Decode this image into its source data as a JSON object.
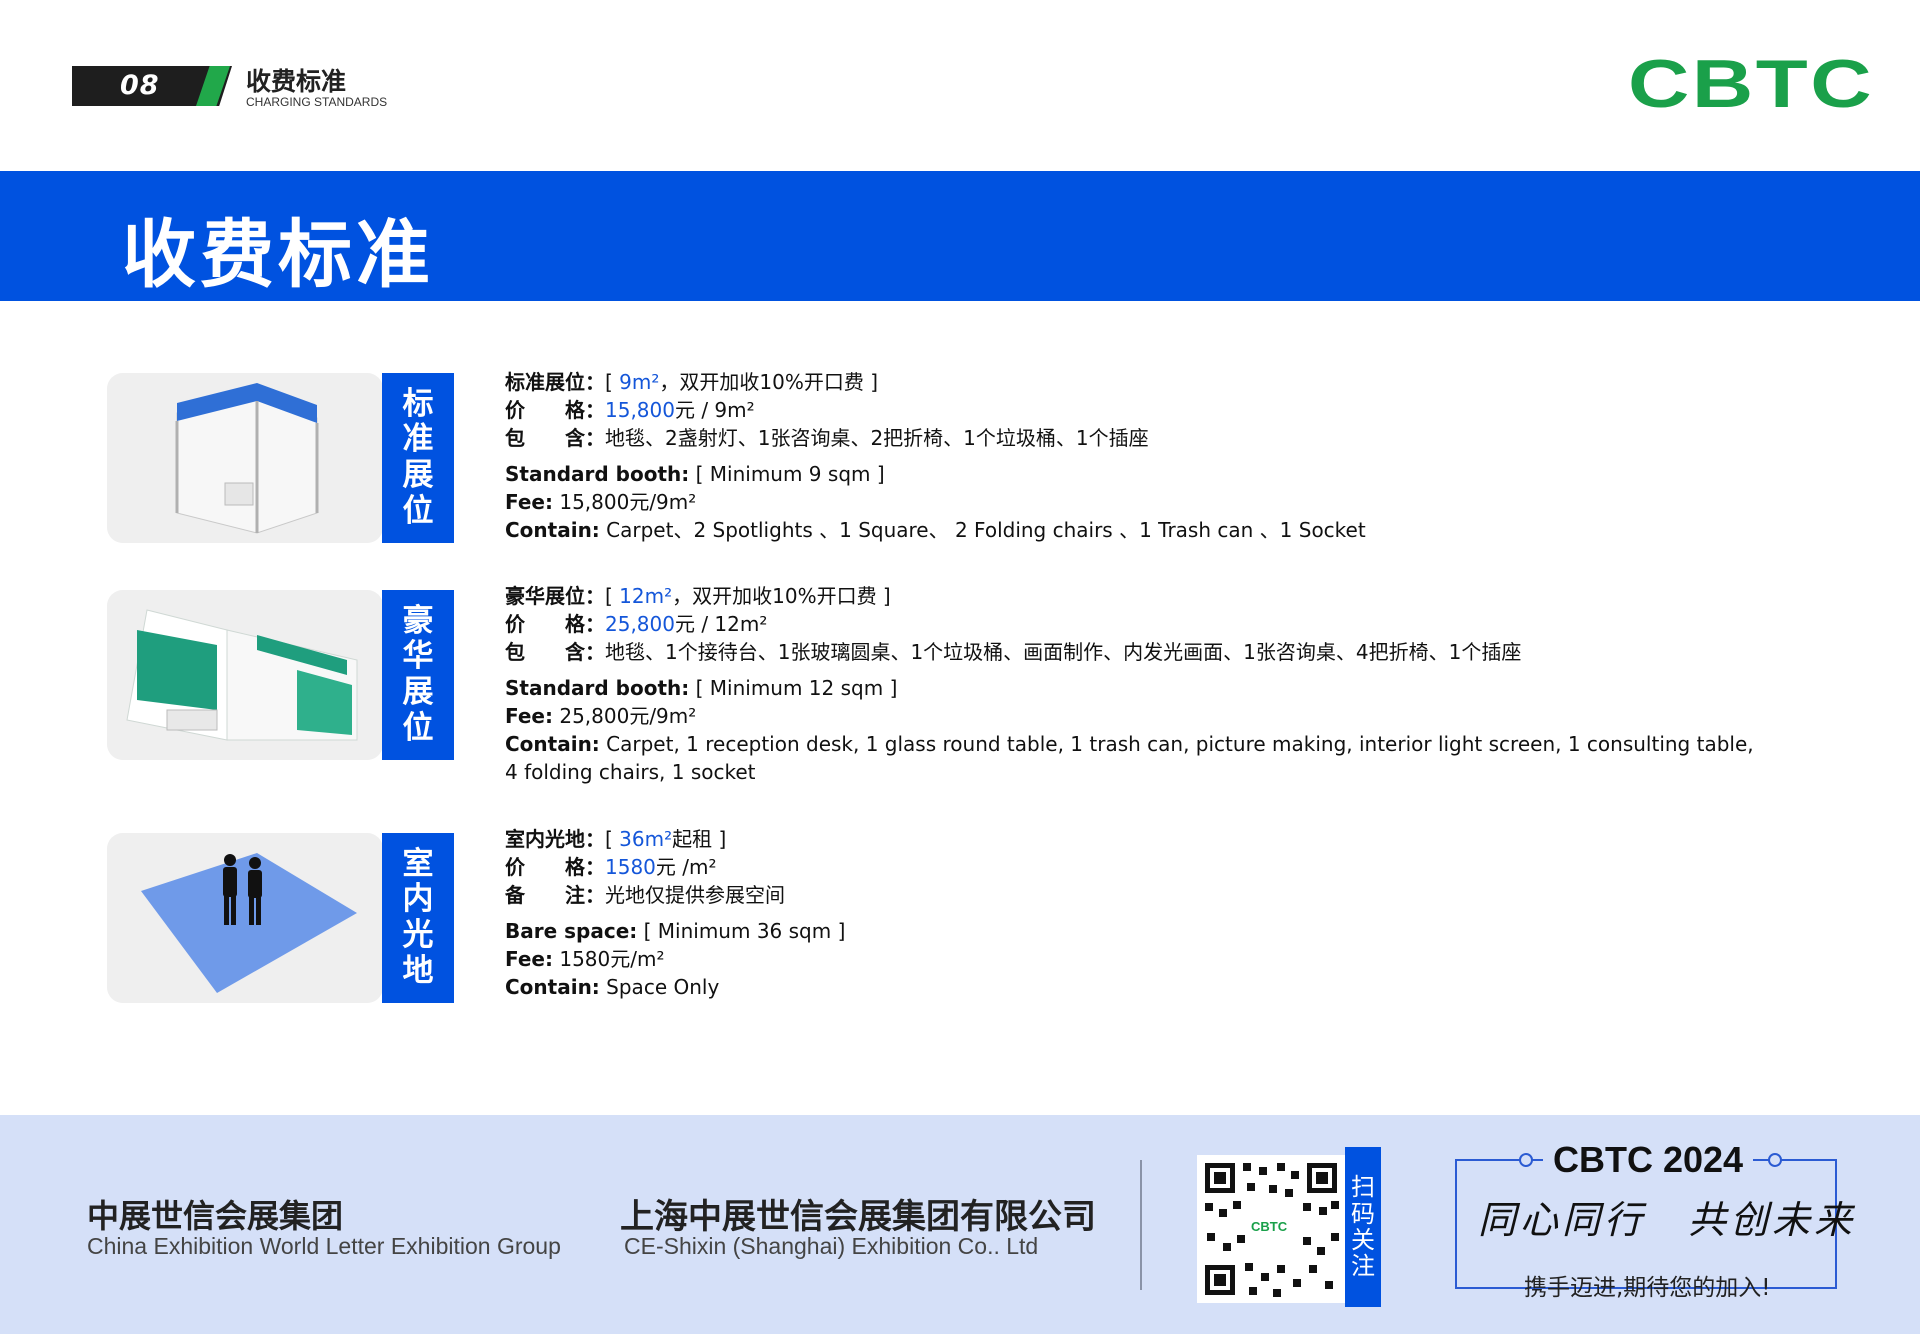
{
  "header": {
    "page_number": "08",
    "title": "收费标准",
    "subtitle": "CHARGING STANDARDS",
    "logo_text": "CBTC"
  },
  "banner": {
    "title": "收费标准"
  },
  "booths": [
    {
      "tag": [
        "标",
        "准",
        "展",
        "位"
      ],
      "cn_lines": {
        "label1": "标准展位：",
        "v1_pre": "[ ",
        "v1_blue": "9m²",
        "v1_post": "，双开加收10%开口费 ]",
        "label2": "价　　格：",
        "v2_blue": "15,800",
        "v2_post": "元 / 9m²",
        "label3": "包　　含：",
        "v3": "地毯、2盏射灯、1张咨询桌、2把折椅、1个垃圾桶、1个插座"
      },
      "en_lines": {
        "label1": "Standard booth:",
        "v1": " [ Minimum 9 sqm ]",
        "label2": "Fee:",
        "v2": " 15,800元/9m²",
        "label3": "Contain:",
        "v3": " Carpet、2 Spotlights 、1 Square、 2 Folding chairs 、1 Trash can 、1 Socket"
      }
    },
    {
      "tag": [
        "豪",
        "华",
        "展",
        "位"
      ],
      "cn_lines": {
        "label1": "豪华展位：",
        "v1_pre": "[ ",
        "v1_blue": "12m²",
        "v1_post": "，双开加收10%开口费 ]",
        "label2": "价　　格：",
        "v2_blue": "25,800",
        "v2_post": "元 / 12m²",
        "label3": "包　　含：",
        "v3": "地毯、1个接待台、1张玻璃圆桌、1个垃圾桶、画面制作、内发光画面、1张咨询桌、4把折椅、1个插座"
      },
      "en_lines": {
        "label1": "Standard booth:",
        "v1": " [ Minimum 12 sqm ]",
        "label2": "Fee:",
        "v2": " 25,800元/9m²",
        "label3": "Contain:",
        "v3": " Carpet, 1 reception desk, 1 glass round table, 1 trash can, picture making, interior light screen, 1 consulting table, 4 folding chairs, 1 socket"
      }
    },
    {
      "tag": [
        "室",
        "内",
        "光",
        "地"
      ],
      "cn_lines": {
        "label1": "室内光地：",
        "v1_pre": "[ ",
        "v1_blue": "36m²",
        "v1_post": "起租 ]",
        "label2": "价　　格：",
        "v2_blue": "1580",
        "v2_post": "元 /m²",
        "label3": "备　　注：",
        "v3": "光地仅提供参展空间"
      },
      "en_lines": {
        "label1": "Bare space:",
        "v1": " [ Minimum 36 sqm ]",
        "label2": "Fee:",
        "v2": " 1580元/m²",
        "label3": "Contain:",
        "v3": " Space Only"
      }
    }
  ],
  "footer": {
    "company_cn": "中展世信会展集团",
    "company_en": "China Exhibition World Letter Exhibition Group",
    "company2_cn": "上海中展世信会展集团有限公司",
    "company2_en": "CE-Shixin (Shanghai) Exhibition Co.. Ltd",
    "qr_tag": [
      "扫",
      "码",
      "关",
      "注"
    ],
    "qr_logo": "CBTC",
    "slogan_head": "CBTC 2024",
    "slogan": "同心同行　共创未来",
    "slogan_foot": "携手迈进,期待您的加入!"
  },
  "colors": {
    "brand_blue": "#0052e0",
    "brand_green": "#1aa04a",
    "footer_bg": "#d5e0f8"
  }
}
